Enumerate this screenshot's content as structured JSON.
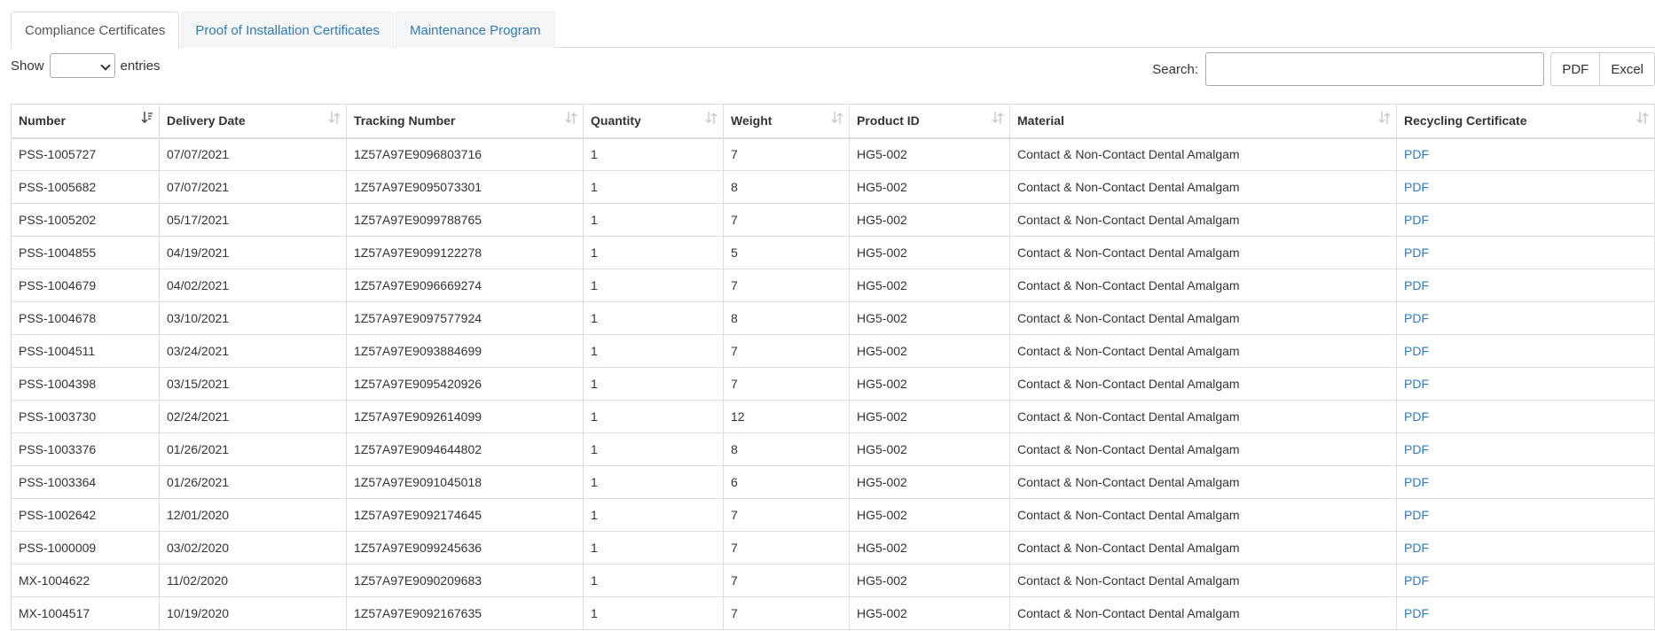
{
  "tabs": [
    {
      "label": "Compliance Certificates",
      "active": true
    },
    {
      "label": "Proof of Installation Certificates",
      "active": false
    },
    {
      "label": "Maintenance Program",
      "active": false
    }
  ],
  "length": {
    "prefix": "Show",
    "suffix": "entries",
    "selected": ""
  },
  "search": {
    "label": "Search:",
    "value": "",
    "placeholder": ""
  },
  "export_buttons": {
    "pdf": "PDF",
    "excel": "Excel"
  },
  "table": {
    "columns": [
      "Number",
      "Delivery Date",
      "Tracking Number",
      "Quantity",
      "Weight",
      "Product ID",
      "Material",
      "Recycling Certificate"
    ],
    "sorted_column": "Number",
    "rows": [
      [
        "PSS-1005727",
        "07/07/2021",
        "1Z57A97E9096803716",
        "1",
        "7",
        "HG5-002",
        "Contact & Non-Contact Dental Amalgam",
        "PDF"
      ],
      [
        "PSS-1005682",
        "07/07/2021",
        "1Z57A97E9095073301",
        "1",
        "8",
        "HG5-002",
        "Contact & Non-Contact Dental Amalgam",
        "PDF"
      ],
      [
        "PSS-1005202",
        "05/17/2021",
        "1Z57A97E9099788765",
        "1",
        "7",
        "HG5-002",
        "Contact & Non-Contact Dental Amalgam",
        "PDF"
      ],
      [
        "PSS-1004855",
        "04/19/2021",
        "1Z57A97E9099122278",
        "1",
        "5",
        "HG5-002",
        "Contact & Non-Contact Dental Amalgam",
        "PDF"
      ],
      [
        "PSS-1004679",
        "04/02/2021",
        "1Z57A97E9096669274",
        "1",
        "7",
        "HG5-002",
        "Contact & Non-Contact Dental Amalgam",
        "PDF"
      ],
      [
        "PSS-1004678",
        "03/10/2021",
        "1Z57A97E9097577924",
        "1",
        "8",
        "HG5-002",
        "Contact & Non-Contact Dental Amalgam",
        "PDF"
      ],
      [
        "PSS-1004511",
        "03/24/2021",
        "1Z57A97E9093884699",
        "1",
        "7",
        "HG5-002",
        "Contact & Non-Contact Dental Amalgam",
        "PDF"
      ],
      [
        "PSS-1004398",
        "03/15/2021",
        "1Z57A97E9095420926",
        "1",
        "7",
        "HG5-002",
        "Contact & Non-Contact Dental Amalgam",
        "PDF"
      ],
      [
        "PSS-1003730",
        "02/24/2021",
        "1Z57A97E9092614099",
        "1",
        "12",
        "HG5-002",
        "Contact & Non-Contact Dental Amalgam",
        "PDF"
      ],
      [
        "PSS-1003376",
        "01/26/2021",
        "1Z57A97E9094644802",
        "1",
        "8",
        "HG5-002",
        "Contact & Non-Contact Dental Amalgam",
        "PDF"
      ],
      [
        "PSS-1003364",
        "01/26/2021",
        "1Z57A97E9091045018",
        "1",
        "6",
        "HG5-002",
        "Contact & Non-Contact Dental Amalgam",
        "PDF"
      ],
      [
        "PSS-1002642",
        "12/01/2020",
        "1Z57A97E9092174645",
        "1",
        "7",
        "HG5-002",
        "Contact & Non-Contact Dental Amalgam",
        "PDF"
      ],
      [
        "PSS-1000009",
        "03/02/2020",
        "1Z57A97E9099245636",
        "1",
        "7",
        "HG5-002",
        "Contact & Non-Contact Dental Amalgam",
        "PDF"
      ],
      [
        "MX-1004622",
        "11/02/2020",
        "1Z57A97E9090209683",
        "1",
        "7",
        "HG5-002",
        "Contact & Non-Contact Dental Amalgam",
        "PDF"
      ],
      [
        "MX-1004517",
        "10/19/2020",
        "1Z57A97E9092167635",
        "1",
        "7",
        "HG5-002",
        "Contact & Non-Contact Dental Amalgam",
        "PDF"
      ]
    ]
  },
  "colors": {
    "link": "#337ab7",
    "border": "#dddddd"
  }
}
